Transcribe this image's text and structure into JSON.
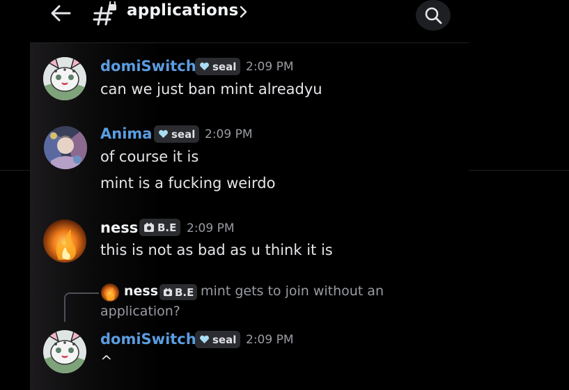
{
  "header": {
    "channel_name": "applications",
    "icons": {
      "back": "arrow-left-icon",
      "channel": "hash-lock-icon",
      "chevron": "chevron-right-icon",
      "search": "search-icon"
    }
  },
  "messages": [
    {
      "author": "domiSwitch",
      "tag": "seal",
      "time": "2:09 PM",
      "lines": [
        "can we just ban mint alreadyu"
      ],
      "name_color": "#5a9de0",
      "avatar": "snow-leopard-avatar"
    },
    {
      "author": "Anima",
      "tag": "seal",
      "time": "2:09 PM",
      "lines": [
        "of course it is",
        "mint is a fucking weirdo"
      ],
      "name_color": "#5a9de0",
      "avatar": "anime-art-avatar"
    },
    {
      "author": "ness",
      "tag": "B.E",
      "time": "2:09 PM",
      "lines": [
        "this is not as bad as u think it is"
      ],
      "name_color": "#f2f3f5",
      "avatar": "fire-avatar"
    },
    {
      "author": "domiSwitch",
      "tag": "seal",
      "time": "2:09 PM",
      "lines": [
        "^"
      ],
      "name_color": "#5a9de0",
      "avatar": "snow-leopard-avatar",
      "reply": {
        "author": "ness",
        "tag": "B.E",
        "text_line1": "mint gets to join without an",
        "text_line2": "application?"
      }
    }
  ],
  "colors": {
    "background": "#000000",
    "name_blue": "#5a9de0",
    "muted": "#9a9ca3",
    "tag_bg": "#2b2c30"
  }
}
